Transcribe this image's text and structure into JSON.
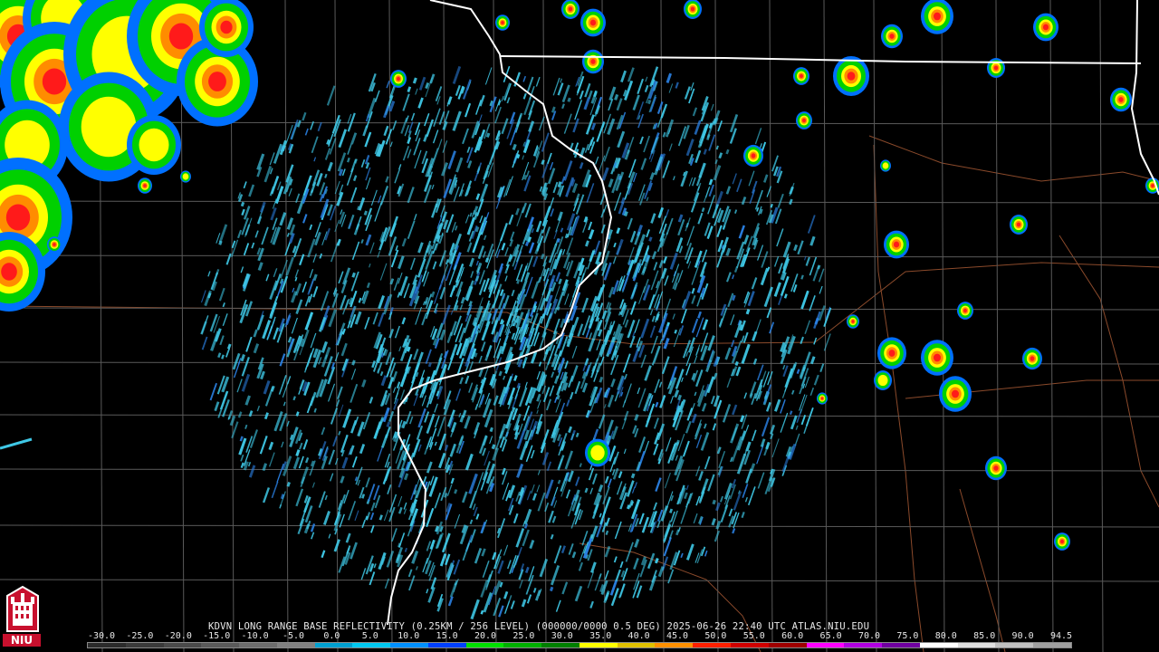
{
  "product": {
    "caption": "KDVN LONG RANGE BASE REFLECTIVITY (0.25KM / 256 LEVEL) (000000/0000 0.5 DEG) 2025-06-26 22:40 UTC  ATLAS.NIU.EDU"
  },
  "logo": {
    "text": "NIU",
    "icon": "niu-castle-icon"
  },
  "scale": {
    "labels": [
      "-30.0",
      "-25.0",
      "-20.0",
      "-15.0",
      "-10.0",
      "-5.0",
      "0.0",
      "5.0",
      "10.0",
      "15.0",
      "20.0",
      "25.0",
      "30.0",
      "35.0",
      "40.0",
      "45.0",
      "50.0",
      "55.0",
      "60.0",
      "65.0",
      "70.0",
      "75.0",
      "80.0",
      "85.0",
      "90.0",
      "94.5"
    ],
    "colors": [
      "#2b2b2b",
      "#3a3a3a",
      "#4a4a4a",
      "#5a5a5a",
      "#6c6c6c",
      "#808080",
      "#00a0d0",
      "#00c8f0",
      "#0090ff",
      "#0040ff",
      "#00e000",
      "#00b000",
      "#008000",
      "#ffff00",
      "#e0c000",
      "#ff9000",
      "#ff2000",
      "#d00000",
      "#a00000",
      "#ff00ff",
      "#b000e0",
      "#7000a0",
      "#ffffff",
      "#e0e0e0",
      "#c0c0c0",
      "#a0a0a0"
    ]
  },
  "colors": {
    "background": "#000000",
    "county_lines": "#5a5a5a",
    "state_lines": "#ffffff",
    "roads": "#8b4a2b",
    "clear_air_echo": "#3fc8e6"
  }
}
